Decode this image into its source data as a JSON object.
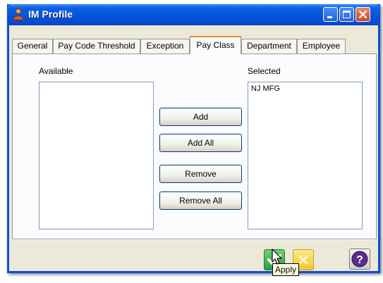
{
  "window": {
    "title": "IM Profile",
    "icons": {
      "app": "user-group-icon",
      "minimize": "minimize-icon",
      "maximize": "maximize-icon",
      "close": "close-icon"
    }
  },
  "tabs": [
    {
      "label": "General",
      "active": false
    },
    {
      "label": "Pay Code Threshold",
      "active": false
    },
    {
      "label": "Exception",
      "active": false
    },
    {
      "label": "Pay Class",
      "active": true
    },
    {
      "label": "Department",
      "active": false
    },
    {
      "label": "Employee",
      "active": false
    }
  ],
  "available": {
    "label": "Available",
    "items": []
  },
  "selected": {
    "label": "Selected",
    "items": [
      "NJ MFG"
    ]
  },
  "buttons": {
    "add": "Add",
    "add_all": "Add All",
    "remove": "Remove",
    "remove_all": "Remove All"
  },
  "footer": {
    "apply_icon": "check-icon",
    "cancel_icon": "cancel-icon",
    "help_icon": "help-icon",
    "tooltip": "Apply"
  },
  "colors": {
    "title_bar": "#0552d9",
    "active_tab_accent": "#e68b2c",
    "apply_green": "#3bb54a",
    "cancel_yellow": "#f8d74a",
    "help_purple": "#5b2d8c"
  }
}
